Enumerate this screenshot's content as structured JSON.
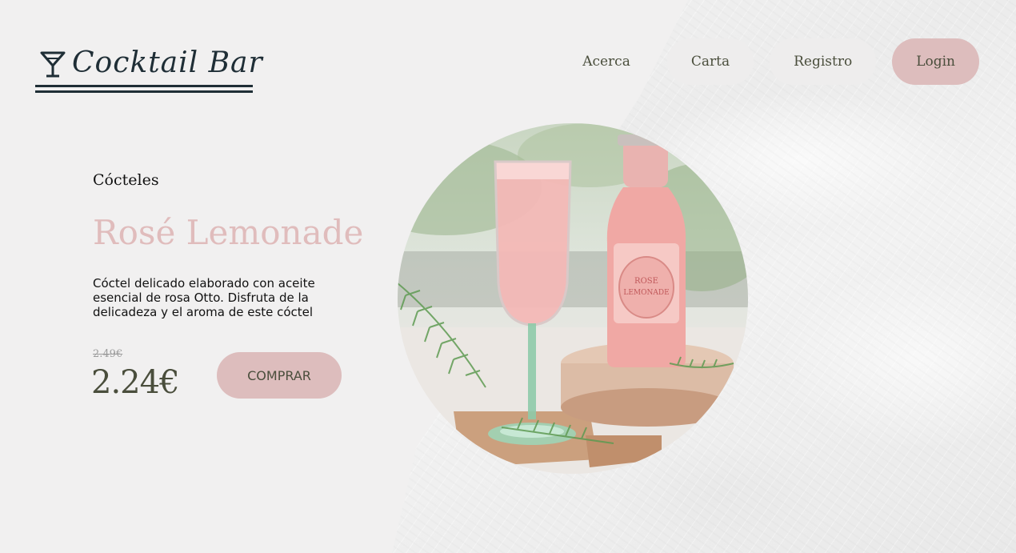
{
  "brand": {
    "name": "Cocktail Bar",
    "icon": "cocktail-glass-icon"
  },
  "nav": {
    "items": [
      {
        "label": "Acerca"
      },
      {
        "label": "Carta"
      },
      {
        "label": "Registro"
      },
      {
        "label": "Login"
      }
    ]
  },
  "product": {
    "category": "Cócteles",
    "name": "Rosé Lemonade",
    "description": "Cóctel delicado elaborado con aceite esencial de rosa Otto. Disfruta de la delicadeza y el aroma de este cóctel",
    "old_price": "2.49€",
    "price": "2.24€",
    "buy_label": "COMPRAR",
    "image_icon": "rose-lemonade-photo"
  },
  "colors": {
    "background": "#f1f0f0",
    "accent_pink": "#ddbdbd",
    "title_pink": "#e0bcbc",
    "dark_text": "#1f2e36",
    "olive_text": "#4a4e3c"
  }
}
